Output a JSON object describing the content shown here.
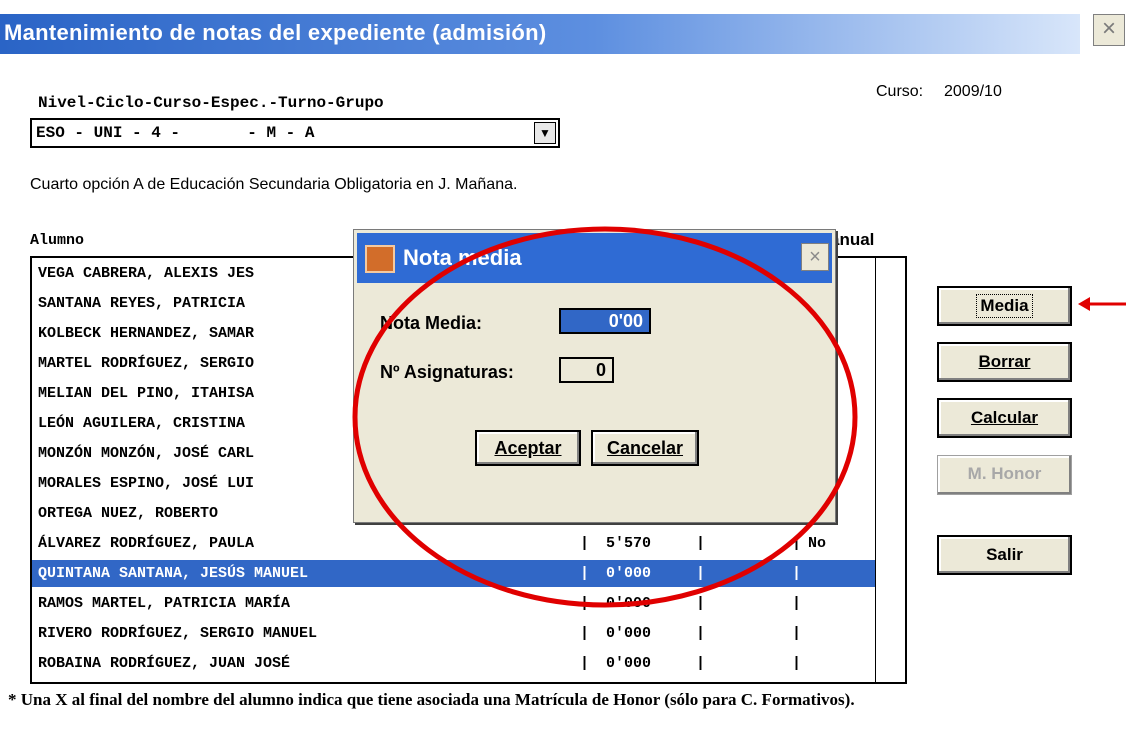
{
  "window": {
    "title": "Mantenimiento de notas del expediente (admisión)",
    "close_glyph": "×"
  },
  "header": {
    "nivel_label": "Nivel-Ciclo-Curso-Espec.-Turno-Grupo",
    "curso_label": "Curso:",
    "curso_value": "2009/10",
    "combo_value": "ESO - UNI - 4 -       - M - A",
    "description": "Cuarto opción A  de Educación Secundaria Obligatoria en J. Mañana."
  },
  "list": {
    "col_alumno": "Alumno",
    "col_manual": "anual",
    "rows": [
      {
        "name": "VEGA CABRERA, ALEXIS JES",
        "nota": "",
        "mh": ""
      },
      {
        "name": "SANTANA REYES, PATRICIA",
        "nota": "",
        "mh": ""
      },
      {
        "name": "KOLBECK HERNANDEZ, SAMAR",
        "nota": "",
        "mh": ""
      },
      {
        "name": "MARTEL RODRÍGUEZ, SERGIO",
        "nota": "",
        "mh": ""
      },
      {
        "name": "MELIAN DEL PINO, ITAHISA",
        "nota": "",
        "mh": ""
      },
      {
        "name": "LEÓN AGUILERA, CRISTINA",
        "nota": "",
        "mh": ""
      },
      {
        "name": "MONZÓN MONZÓN, JOSÉ CARL",
        "nota": "",
        "mh": ""
      },
      {
        "name": "MORALES ESPINO, JOSÉ LUI",
        "nota": "",
        "mh": ""
      },
      {
        "name": "ORTEGA NUEZ, ROBERTO",
        "nota": "",
        "mh": ""
      },
      {
        "name": "ÁLVAREZ RODRÍGUEZ, PAULA",
        "nota": "5'570",
        "mh": "No"
      },
      {
        "name": "QUINTANA SANTANA, JESÚS MANUEL",
        "nota": "0'000",
        "mh": "",
        "selected": true
      },
      {
        "name": "RAMOS MARTEL, PATRICIA MARÍA",
        "nota": "0'000",
        "mh": ""
      },
      {
        "name": "RIVERO RODRÍGUEZ, SERGIO MANUEL",
        "nota": "0'000",
        "mh": ""
      },
      {
        "name": "ROBAINA RODRÍGUEZ, JUAN JOSÉ",
        "nota": "0'000",
        "mh": ""
      }
    ]
  },
  "buttons": {
    "media": "Media",
    "borrar": "Borrar",
    "calcular": "Calcular",
    "mhonor": "M. Honor",
    "salir": "Salir"
  },
  "footnote": "* Una X al final del nombre del alumno indica que tiene asociada una Matrícula de Honor (sólo  para C. Formativos).",
  "dialog": {
    "title": "Nota media",
    "close_glyph": "×",
    "nota_media_label": "Nota Media:",
    "nota_media_value": "0'00",
    "asignaturas_label": "Nº Asignaturas:",
    "asignaturas_value": "0",
    "aceptar": "Aceptar",
    "cancelar": "Cancelar"
  },
  "colors": {
    "selection": "#3167c6",
    "annotation": "#e00000",
    "dialog_title": "#2f6bd4"
  }
}
